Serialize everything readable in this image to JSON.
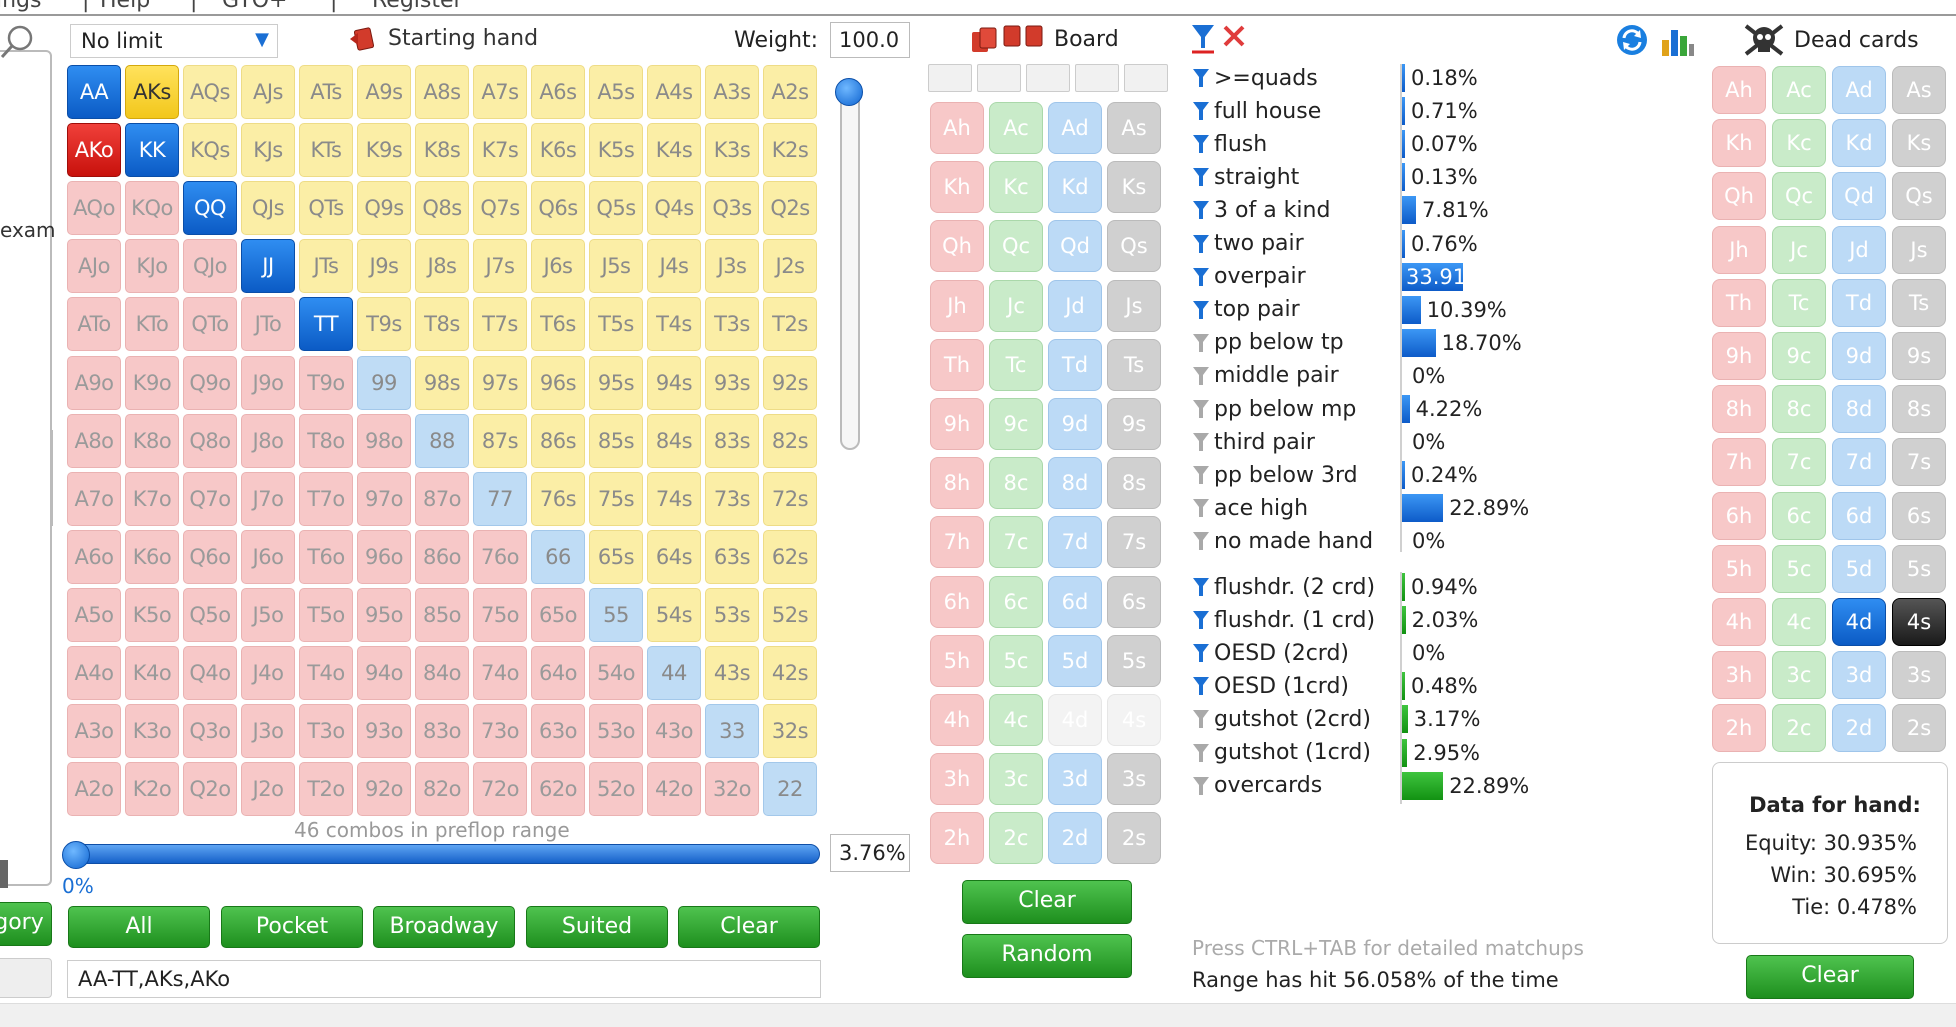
{
  "menu": {
    "items": [
      "ings",
      "Help",
      "GTO+",
      "Register"
    ]
  },
  "left_panel": {
    "partial_text": "exam",
    "category_btn": "gory"
  },
  "header": {
    "limit_value": "No limit",
    "starting_hand_label": "Starting hand",
    "weight_label": "Weight:",
    "weight_value": "100.0"
  },
  "grid": {
    "rows": [
      [
        "AA",
        "AKs",
        "AQs",
        "AJs",
        "ATs",
        "A9s",
        "A8s",
        "A7s",
        "A6s",
        "A5s",
        "A4s",
        "A3s",
        "A2s"
      ],
      [
        "AKo",
        "KK",
        "KQs",
        "KJs",
        "KTs",
        "K9s",
        "K8s",
        "K7s",
        "K6s",
        "K5s",
        "K4s",
        "K3s",
        "K2s"
      ],
      [
        "AQo",
        "KQo",
        "QQ",
        "QJs",
        "QTs",
        "Q9s",
        "Q8s",
        "Q7s",
        "Q6s",
        "Q5s",
        "Q4s",
        "Q3s",
        "Q2s"
      ],
      [
        "AJo",
        "KJo",
        "QJo",
        "JJ",
        "JTs",
        "J9s",
        "J8s",
        "J7s",
        "J6s",
        "J5s",
        "J4s",
        "J3s",
        "J2s"
      ],
      [
        "ATo",
        "KTo",
        "QTo",
        "JTo",
        "TT",
        "T9s",
        "T8s",
        "T7s",
        "T6s",
        "T5s",
        "T4s",
        "T3s",
        "T2s"
      ],
      [
        "A9o",
        "K9o",
        "Q9o",
        "J9o",
        "T9o",
        "99",
        "98s",
        "97s",
        "96s",
        "95s",
        "94s",
        "93s",
        "92s"
      ],
      [
        "A8o",
        "K8o",
        "Q8o",
        "J8o",
        "T8o",
        "98o",
        "88",
        "87s",
        "86s",
        "85s",
        "84s",
        "83s",
        "82s"
      ],
      [
        "A7o",
        "K7o",
        "Q7o",
        "J7o",
        "T7o",
        "97o",
        "87o",
        "77",
        "76s",
        "75s",
        "74s",
        "73s",
        "72s"
      ],
      [
        "A6o",
        "K6o",
        "Q6o",
        "J6o",
        "T6o",
        "96o",
        "86o",
        "76o",
        "66",
        "65s",
        "64s",
        "63s",
        "62s"
      ],
      [
        "A5o",
        "K5o",
        "Q5o",
        "J5o",
        "T5o",
        "95o",
        "85o",
        "75o",
        "65o",
        "55",
        "54s",
        "53s",
        "52s"
      ],
      [
        "A4o",
        "K4o",
        "Q4o",
        "J4o",
        "T4o",
        "94o",
        "84o",
        "74o",
        "64o",
        "54o",
        "44",
        "43s",
        "42s"
      ],
      [
        "A3o",
        "K3o",
        "Q3o",
        "J3o",
        "T3o",
        "93o",
        "83o",
        "73o",
        "63o",
        "53o",
        "43o",
        "33",
        "32s"
      ],
      [
        "A2o",
        "K2o",
        "Q2o",
        "J2o",
        "T2o",
        "92o",
        "82o",
        "72o",
        "62o",
        "52o",
        "42o",
        "32o",
        "22"
      ]
    ],
    "selected": [
      "AA",
      "KK",
      "QQ",
      "JJ",
      "TT",
      "AKs",
      "AKo"
    ]
  },
  "range": {
    "combos_text": "46 combos in preflop range",
    "percent": "3.76%",
    "slider_min": "0%",
    "buttons": [
      "All",
      "Pocket",
      "Broadway",
      "Suited",
      "Clear"
    ],
    "text": "AA-TT,AKs,AKo"
  },
  "board": {
    "label": "Board",
    "ranks": [
      "A",
      "K",
      "Q",
      "J",
      "T",
      "9",
      "8",
      "7",
      "6",
      "5",
      "4",
      "3",
      "2"
    ],
    "suits": [
      "h",
      "c",
      "d",
      "s"
    ],
    "disabled": [
      "4d",
      "4s"
    ],
    "clear_label": "Clear",
    "random_label": "Random"
  },
  "stats": {
    "made_hands": [
      {
        "label": ">=quads",
        "value": "0.18%",
        "pct": 0.18,
        "filter": true
      },
      {
        "label": "full house",
        "value": "0.71%",
        "pct": 0.71,
        "filter": true
      },
      {
        "label": "flush",
        "value": "0.07%",
        "pct": 0.07,
        "filter": true
      },
      {
        "label": "straight",
        "value": "0.13%",
        "pct": 0.13,
        "filter": true
      },
      {
        "label": "3 of a kind",
        "value": "7.81%",
        "pct": 7.81,
        "filter": true
      },
      {
        "label": "two pair",
        "value": "0.76%",
        "pct": 0.76,
        "filter": true
      },
      {
        "label": "overpair",
        "value": "33.91%",
        "pct": 33.91,
        "filter": true,
        "highlight": true
      },
      {
        "label": "top pair",
        "value": "10.39%",
        "pct": 10.39,
        "filter": true
      },
      {
        "label": "pp below tp",
        "value": "18.70%",
        "pct": 18.7,
        "filter": false
      },
      {
        "label": "middle pair",
        "value": "0%",
        "pct": 0,
        "filter": false
      },
      {
        "label": "pp below mp",
        "value": "4.22%",
        "pct": 4.22,
        "filter": false
      },
      {
        "label": "third pair",
        "value": "0%",
        "pct": 0,
        "filter": false
      },
      {
        "label": "pp below 3rd",
        "value": "0.24%",
        "pct": 0.24,
        "filter": false
      },
      {
        "label": "ace high",
        "value": "22.89%",
        "pct": 22.89,
        "filter": false
      },
      {
        "label": "no made hand",
        "value": "0%",
        "pct": 0,
        "filter": false
      }
    ],
    "draws": [
      {
        "label": "flushdr. (2 crd)",
        "value": "0.94%",
        "pct": 0.94,
        "filter": true
      },
      {
        "label": "flushdr. (1 crd)",
        "value": "2.03%",
        "pct": 2.03,
        "filter": true
      },
      {
        "label": "OESD (2crd)",
        "value": "0%",
        "pct": 0,
        "filter": true
      },
      {
        "label": "OESD (1crd)",
        "value": "0.48%",
        "pct": 0.48,
        "filter": true
      },
      {
        "label": "gutshot (2crd)",
        "value": "3.17%",
        "pct": 3.17,
        "filter": false
      },
      {
        "label": "gutshot (1crd)",
        "value": "2.95%",
        "pct": 2.95,
        "filter": false
      },
      {
        "label": "overcards",
        "value": "22.89%",
        "pct": 22.89,
        "filter": false
      }
    ],
    "hint": "Press CTRL+TAB for detailed matchups",
    "hit_text": "Range has hit 56.058% of the time"
  },
  "dead": {
    "label": "Dead cards",
    "selected": [
      "4d",
      "4s"
    ],
    "data_title": "Data for hand:",
    "equity": "Equity: 30.935%",
    "win": "Win: 30.695%",
    "tie": "Tie: 0.478%",
    "clear_label": "Clear"
  },
  "colors": {
    "accent_blue": "#0b5bc5",
    "accent_green": "#1e8f1e",
    "suited": "#fbeea6",
    "offsuit": "#f7c8c8",
    "pair": "#bfdcf5"
  }
}
